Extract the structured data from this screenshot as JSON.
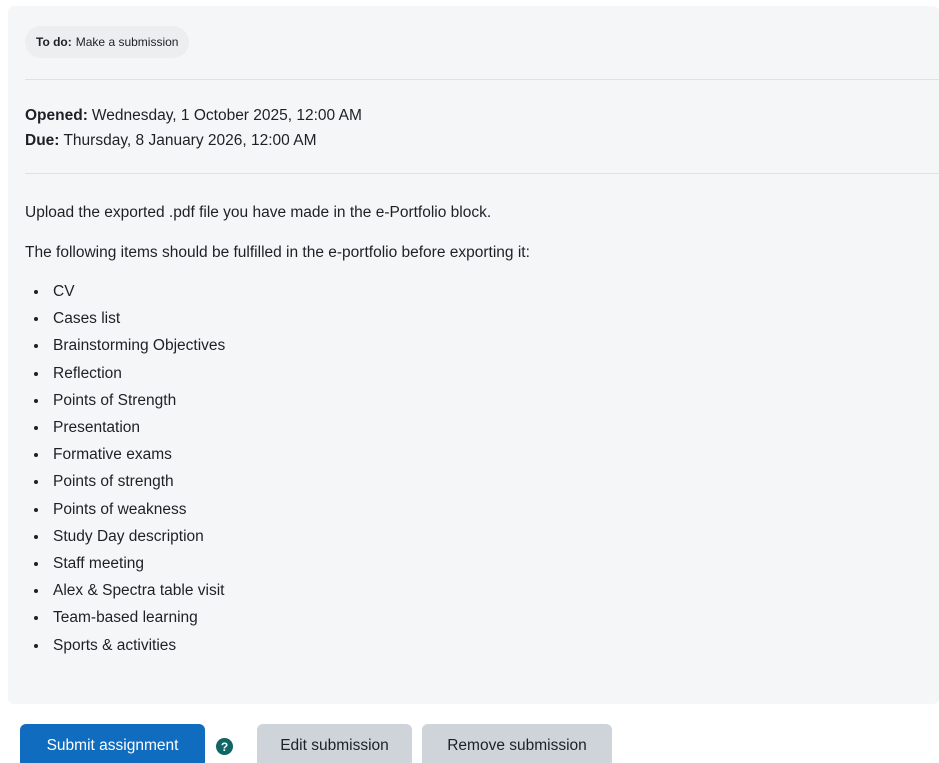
{
  "todo": {
    "label": "To do:",
    "text": "Make a submission"
  },
  "dates": {
    "opened_label": "Opened:",
    "opened_value": "Wednesday, 1 October 2025, 12:00 AM",
    "due_label": "Due:",
    "due_value": "Thursday, 8 January 2026, 12:00 AM"
  },
  "description": {
    "intro": "Upload the exported .pdf file you have made in the e-Portfolio block.",
    "requirements_lead": "The following items should be fulfilled in the e-portfolio before exporting it:",
    "items": [
      "CV",
      "Cases list",
      "Brainstorming Objectives",
      "Reflection",
      "Points of Strength",
      "Presentation",
      "Formative exams",
      "Points of strength",
      "Points of weakness",
      "Study Day description",
      "Staff meeting",
      "Alex & Spectra table visit",
      "Team-based learning",
      "Sports & activities"
    ]
  },
  "actions": {
    "submit_label": "Submit assignment",
    "help_glyph": "?",
    "edit_label": "Edit submission",
    "remove_label": "Remove submission"
  },
  "colors": {
    "primary": "#0f6cbf",
    "secondary": "#ced4da",
    "help_icon": "#0f6664",
    "panel_bg": "#f5f6f7"
  },
  "icons": {
    "help": "question-circle-icon"
  }
}
